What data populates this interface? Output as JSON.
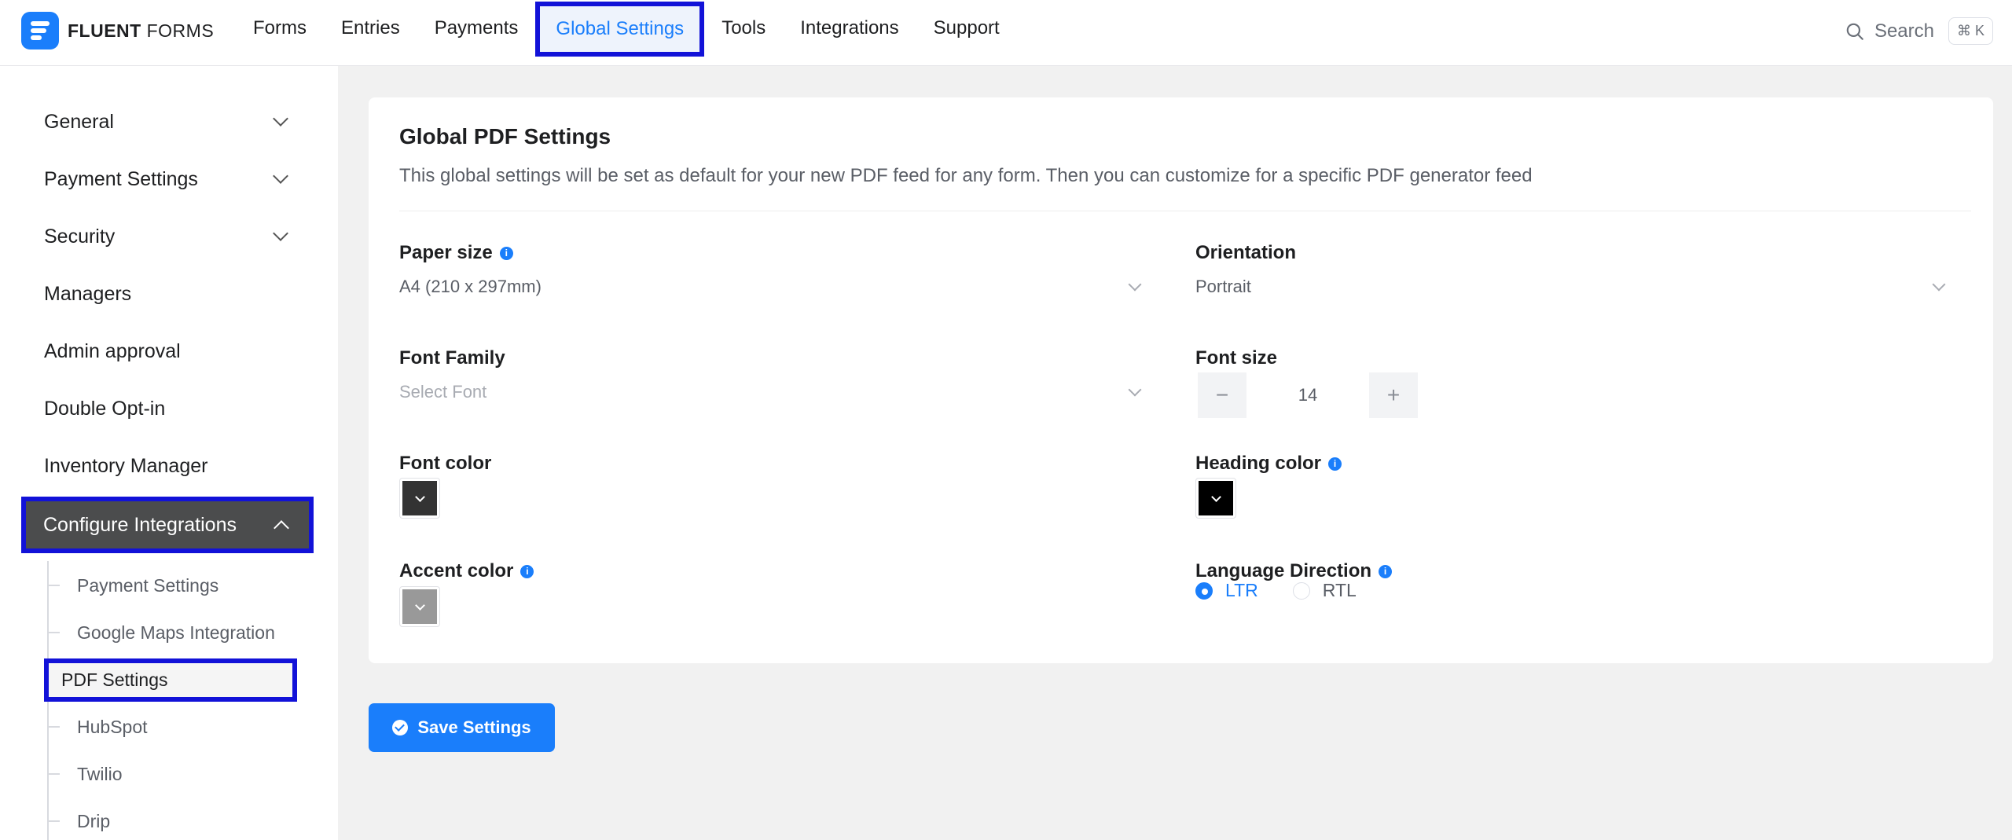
{
  "app": {
    "logo_bold": "FLUENT",
    "logo_light": " FORMS"
  },
  "nav": {
    "items": [
      "Forms",
      "Entries",
      "Payments",
      "Global Settings",
      "Tools",
      "Integrations",
      "Support"
    ],
    "active": "Global Settings"
  },
  "search": {
    "label": "Search",
    "shortcut": "⌘ K"
  },
  "sidebar": {
    "items": [
      {
        "label": "General",
        "expandable": true
      },
      {
        "label": "Payment Settings",
        "expandable": true
      },
      {
        "label": "Security",
        "expandable": true
      },
      {
        "label": "Managers",
        "expandable": false
      },
      {
        "label": "Admin approval",
        "expandable": false
      },
      {
        "label": "Double Opt-in",
        "expandable": false
      },
      {
        "label": "Inventory Manager",
        "expandable": false
      },
      {
        "label": "Configure Integrations",
        "expandable": true,
        "open": true
      }
    ],
    "sub_items": [
      "Payment Settings",
      "Google Maps Integration",
      "PDF Settings",
      "HubSpot",
      "Twilio",
      "Drip"
    ],
    "active_sub": "PDF Settings"
  },
  "main": {
    "title": "Global PDF Settings",
    "description": "This global settings will be set as default for your new PDF feed for any form. Then you can customize for a specific PDF generator feed",
    "paper_size": {
      "label": "Paper size",
      "value": "A4 (210 x 297mm)"
    },
    "orientation": {
      "label": "Orientation",
      "value": "Portrait"
    },
    "font_family": {
      "label": "Font Family",
      "placeholder": "Select Font"
    },
    "font_size": {
      "label": "Font size",
      "value": "14",
      "minus": "−",
      "plus": "+"
    },
    "font_color": {
      "label": "Font color",
      "color": "#333333"
    },
    "heading_color": {
      "label": "Heading color",
      "color": "#000000"
    },
    "accent_color": {
      "label": "Accent color",
      "color": "#999999"
    },
    "language_direction": {
      "label": "Language Direction",
      "options": [
        "LTR",
        "RTL"
      ],
      "selected": "LTR"
    },
    "save_label": "Save Settings"
  },
  "colors": {
    "accent": "#1a7efb",
    "highlight_border": "#1212d8",
    "sidebar_open_bg": "#4b4c4d"
  }
}
